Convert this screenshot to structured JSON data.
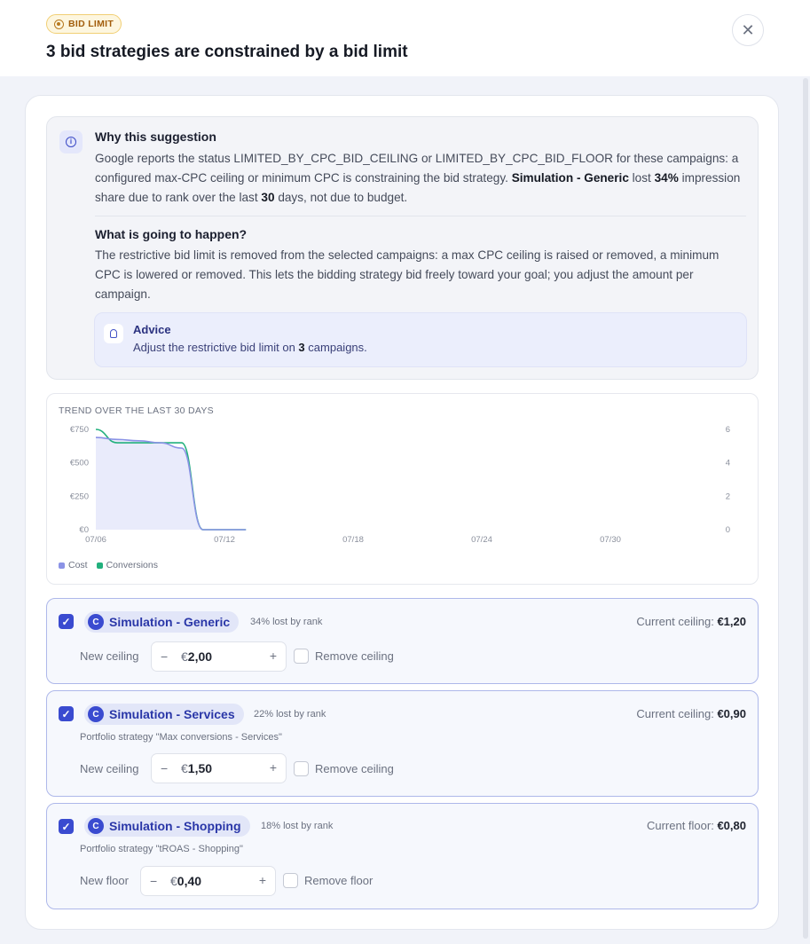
{
  "header": {
    "badge": "BID LIMIT",
    "title": "3 bid strategies are constrained by a bid limit"
  },
  "why": {
    "title": "Why this suggestion",
    "text_parts": {
      "a": "Google reports the status LIMITED_BY_CPC_BID_CEILING or LIMITED_BY_CPC_BID_FLOOR for these campaigns: a configured max-CPC ceiling or minimum CPC is constraining the bid strategy.",
      "campaign": "Simulation - Generic",
      "b": "lost",
      "pct": "34%",
      "c": "impression share due to rank over the last",
      "days": "30",
      "d": "days, not due to budget."
    }
  },
  "happen": {
    "title": "What is going to happen?",
    "text": "The restrictive bid limit is removed from the selected campaigns: a max CPC ceiling is raised or removed, a minimum CPC is lowered or removed. This lets the bidding strategy bid freely toward your goal; you adjust the amount per campaign."
  },
  "advice": {
    "title": "Advice",
    "pre": "Adjust the restrictive bid limit on",
    "count": "3",
    "post": "campaigns."
  },
  "chart_data": {
    "type": "line",
    "title": "TREND OVER THE LAST 30 DAYS",
    "x": [
      "07/06",
      "07/07",
      "07/08",
      "07/09",
      "07/10",
      "07/11",
      "07/12",
      "07/13"
    ],
    "x_ticks": [
      "07/06",
      "07/12",
      "07/18",
      "07/24",
      "07/30"
    ],
    "y_left_ticks": [
      "€0",
      "€250",
      "€500",
      "€750"
    ],
    "y_right_ticks": [
      "0",
      "2",
      "4",
      "6"
    ],
    "ylim_left": [
      0,
      750
    ],
    "ylim_right": [
      0,
      6
    ],
    "series": [
      {
        "name": "Cost",
        "axis": "left",
        "color": "#8b93e6",
        "values": [
          690,
          675,
          665,
          650,
          610,
          0,
          0,
          0
        ]
      },
      {
        "name": "Conversions",
        "axis": "right",
        "color": "#22b07d",
        "values": [
          6.0,
          5.2,
          5.2,
          5.2,
          5.2,
          0,
          0,
          0
        ]
      }
    ],
    "legend": "bottom-left"
  },
  "campaigns": [
    {
      "name": "Simulation - Generic",
      "lost": "34% lost by rank",
      "current_label": "Current ceiling:",
      "current_value": "€1,20",
      "portfolio": "",
      "field_label": "New ceiling",
      "currency": "€",
      "value": "2,00",
      "remove_label": "Remove ceiling",
      "checked": true
    },
    {
      "name": "Simulation - Services",
      "lost": "22% lost by rank",
      "current_label": "Current ceiling:",
      "current_value": "€0,90",
      "portfolio": "Portfolio strategy \"Max conversions - Services\"",
      "field_label": "New ceiling",
      "currency": "€",
      "value": "1,50",
      "remove_label": "Remove ceiling",
      "checked": true
    },
    {
      "name": "Simulation - Shopping",
      "lost": "18% lost by rank",
      "current_label": "Current floor:",
      "current_value": "€0,80",
      "portfolio": "Portfolio strategy \"tROAS - Shopping\"",
      "field_label": "New floor",
      "currency": "€",
      "value": "0,40",
      "remove_label": "Remove floor",
      "checked": true
    }
  ],
  "icons": {
    "badge": "target-icon",
    "close": "close-icon",
    "info": "info-icon",
    "advice": "lightbulb-icon",
    "campaign": "campaign-c-icon",
    "check": "checkmark-icon"
  }
}
